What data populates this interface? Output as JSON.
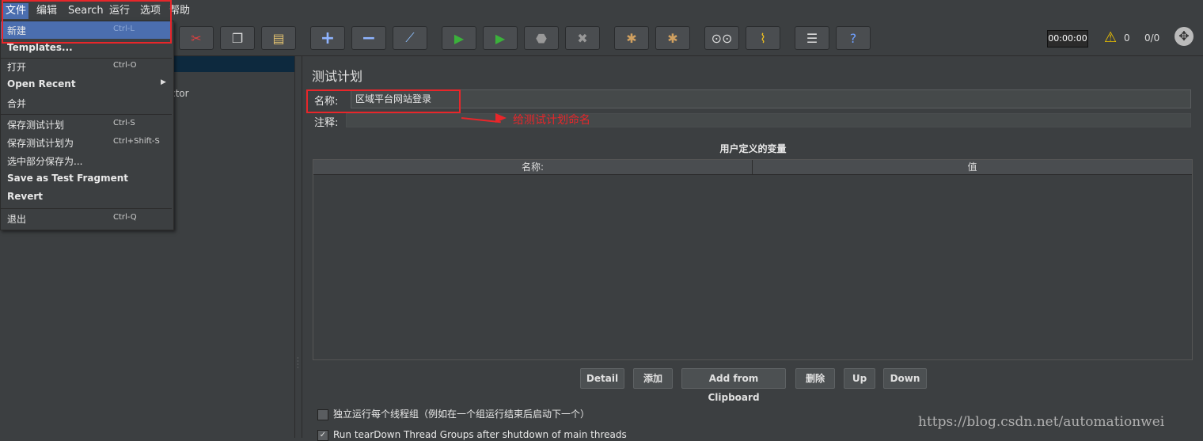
{
  "menubar": {
    "items": [
      "文件",
      "编辑",
      "Search",
      "运行",
      "选项",
      "帮助"
    ]
  },
  "file_menu": {
    "items": [
      {
        "label": "新建",
        "shortcut": "Ctrl-L"
      },
      {
        "label": "Templates...",
        "shortcut": ""
      },
      {
        "label": "打开",
        "shortcut": "Ctrl-O"
      },
      {
        "label": "Open Recent",
        "shortcut": ""
      },
      {
        "label": "合并",
        "shortcut": ""
      },
      {
        "label": "保存测试计划",
        "shortcut": "Ctrl-S"
      },
      {
        "label": "保存测试计划为",
        "shortcut": "Ctrl+Shift-S"
      },
      {
        "label": "选中部分保存为...",
        "shortcut": ""
      },
      {
        "label": "Save as Test Fragment",
        "shortcut": ""
      },
      {
        "label": "Revert",
        "shortcut": ""
      },
      {
        "label": "退出",
        "shortcut": "Ctrl-Q"
      }
    ]
  },
  "toolbar": {
    "timer": "00:00:00",
    "warnings": "0",
    "threads": "0/0"
  },
  "tree": {
    "partial_text": "ctor"
  },
  "test_plan": {
    "title": "测试计划",
    "name_label": "名称:",
    "name_value": "区域平台网站登录",
    "comment_label": "注释:",
    "vars_title": "用户定义的变量",
    "col_name": "名称:",
    "col_value": "值",
    "buttons": {
      "detail": "Detail",
      "add": "添加",
      "add_clipboard": "Add from Clipboard",
      "delete": "删除",
      "up": "Up",
      "down": "Down"
    },
    "option_1": "独立运行每个线程组（例如在一个组运行结束后启动下一个）",
    "option_2": "Run tearDown Thread Groups after shutdown of main threads"
  },
  "annotation": {
    "text": "给测试计划命名",
    "color": "#e8262a"
  },
  "watermark": "https://blog.csdn.net/automationwei"
}
